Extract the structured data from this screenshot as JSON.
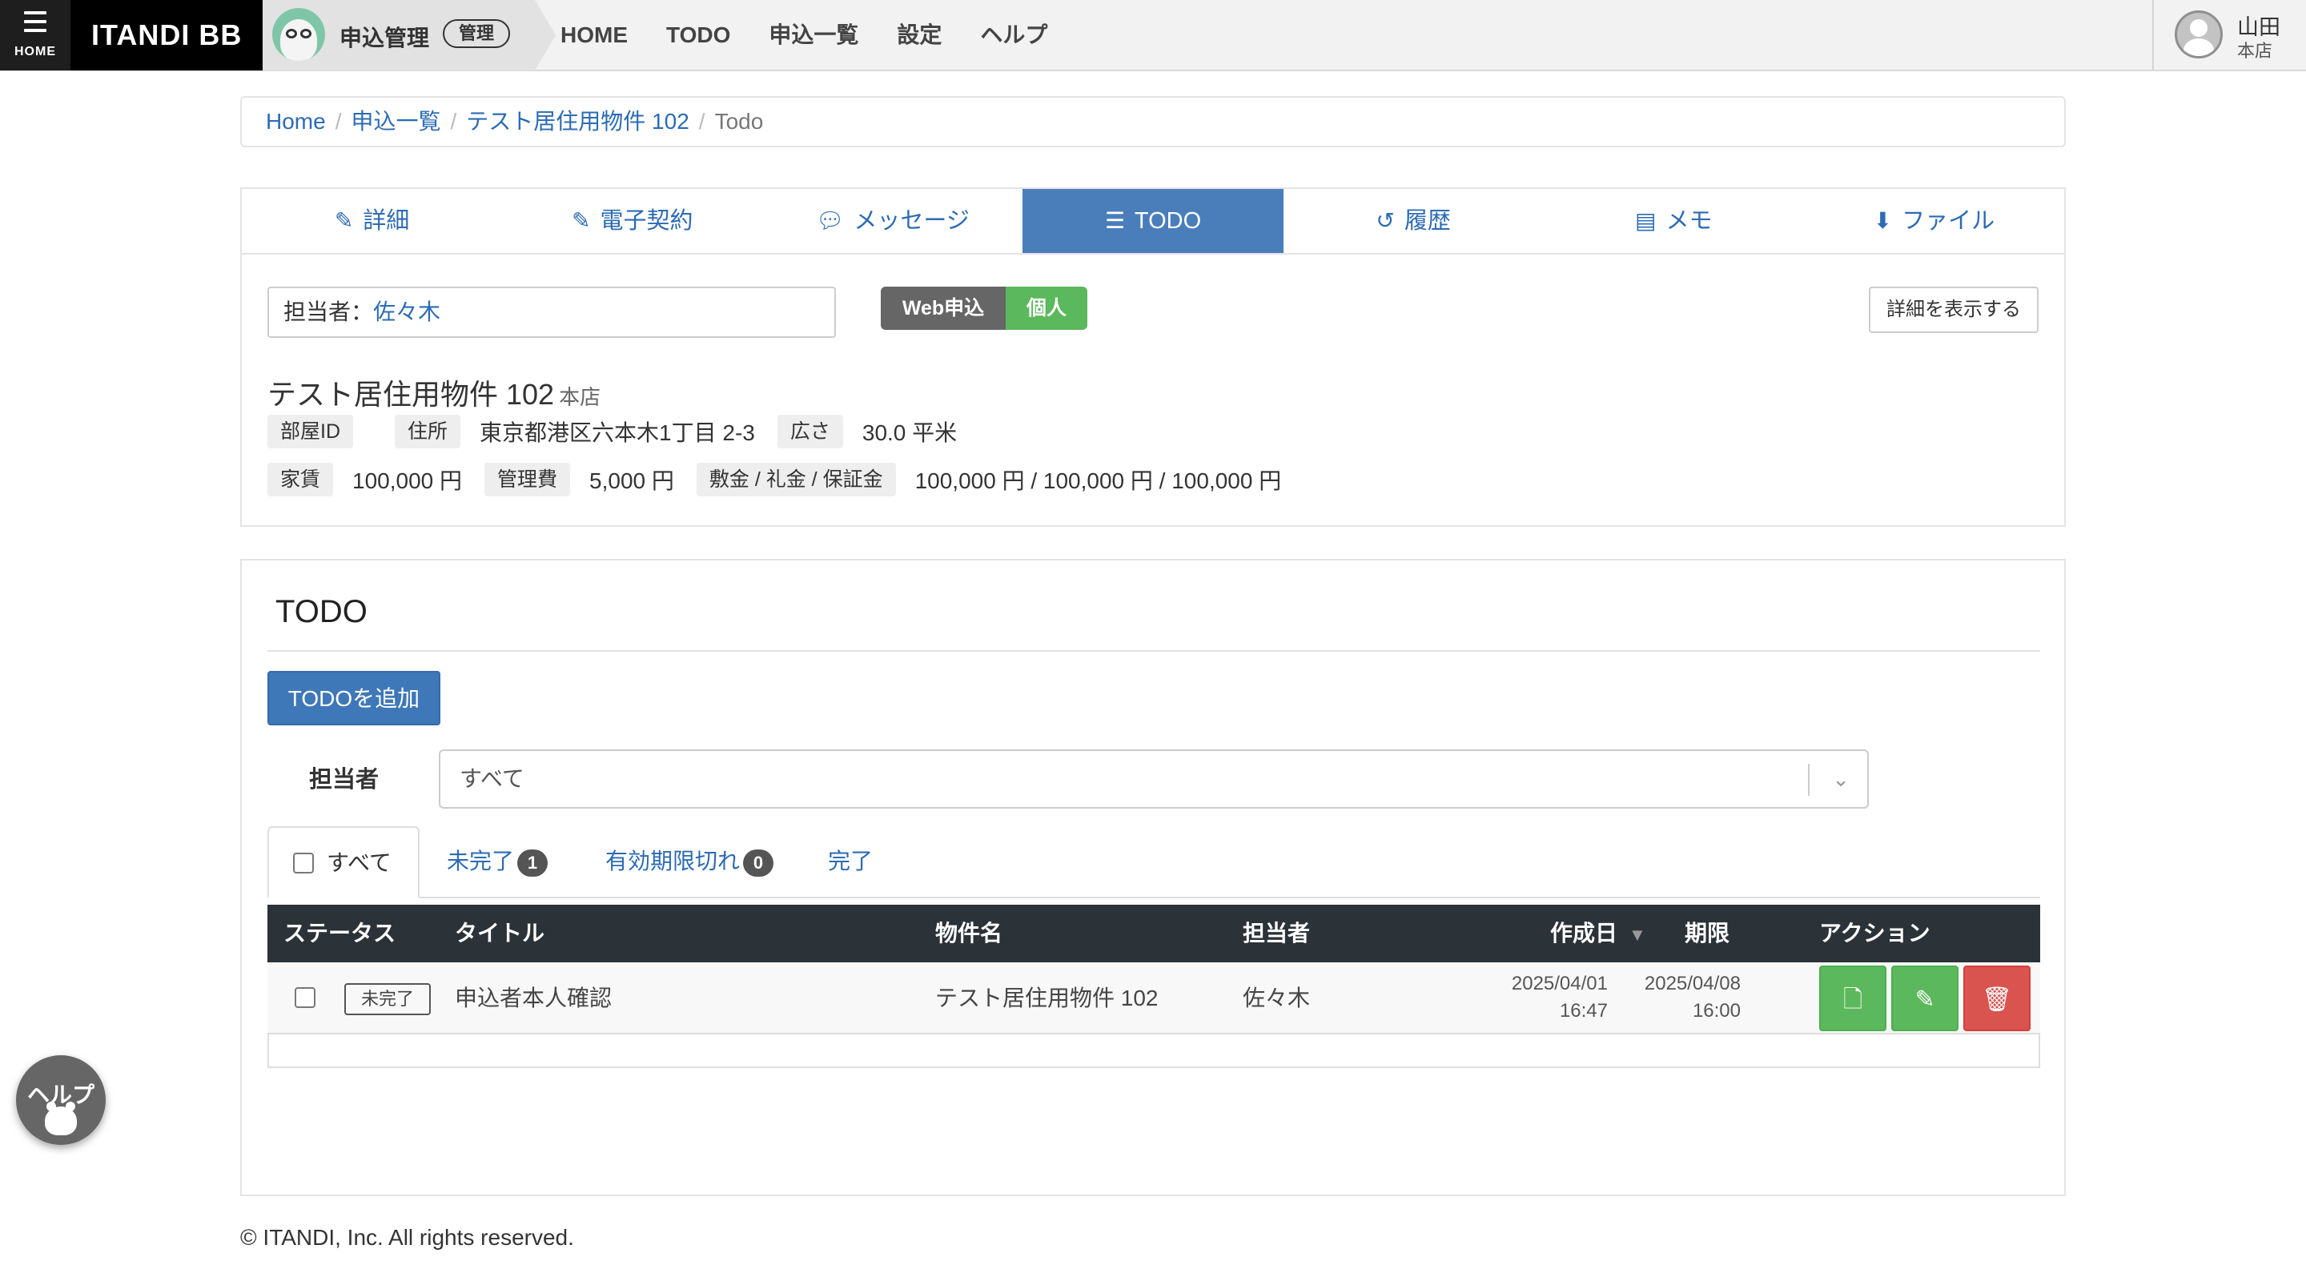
{
  "header": {
    "home_label": "HOME",
    "brand": "ITANDI BB",
    "app_title": "申込管理",
    "app_badge": "管理",
    "nav": [
      "HOME",
      "TODO",
      "申込一覧",
      "設定",
      "ヘルプ"
    ],
    "user_name": "山田",
    "user_store": "本店"
  },
  "breadcrumb": {
    "items": [
      "Home",
      "申込一覧",
      "テスト居住用物件 102"
    ],
    "current": "Todo"
  },
  "tabs": [
    {
      "label": "詳細",
      "icon": "edit-icon"
    },
    {
      "label": "電子契約",
      "icon": "edit-icon"
    },
    {
      "label": "メッセージ",
      "icon": "chat-icon"
    },
    {
      "label": "TODO",
      "icon": "list-icon",
      "active": true
    },
    {
      "label": "履歴",
      "icon": "history-icon"
    },
    {
      "label": "メモ",
      "icon": "memo-icon"
    },
    {
      "label": "ファイル",
      "icon": "download-icon"
    }
  ],
  "detail": {
    "assignee_label": "担当者：",
    "assignee_name": "佐々木",
    "badge_web": "Web申込",
    "badge_type": "個人",
    "show_detail_button": "詳細を表示する",
    "property_name": "テスト居住用物件 102",
    "property_store": "本店",
    "room_id_label": "部屋ID",
    "room_id_value": "",
    "address_label": "住所",
    "address_value": "東京都港区六本木1丁目 2-3",
    "area_label": "広さ",
    "area_value": "30.0 平米",
    "rent_label": "家賃",
    "rent_value": "100,000 円",
    "mgmt_label": "管理費",
    "mgmt_value": "5,000 円",
    "deposit_label": "敷金 / 礼金 / 保証金",
    "deposit_value": "100,000 円 / 100,000 円 / 100,000 円"
  },
  "todo": {
    "heading": "TODO",
    "add_button": "TODOを追加",
    "filter_label": "担当者",
    "filter_value": "すべて",
    "status_tabs": {
      "all": "すべて",
      "incomplete": "未完了",
      "incomplete_count": "1",
      "expired": "有効期限切れ",
      "expired_count": "0",
      "done": "完了"
    },
    "columns": {
      "status": "ステータス",
      "title": "タイトル",
      "property": "物件名",
      "assignee": "担当者",
      "created": "作成日",
      "due": "期限",
      "action": "アクション"
    },
    "rows": [
      {
        "status": "未完了",
        "title": "申込者本人確認",
        "property": "テスト居住用物件 102",
        "assignee": "佐々木",
        "created_date": "2025/04/01",
        "created_time": "16:47",
        "due_date": "2025/04/08",
        "due_time": "16:00"
      }
    ]
  },
  "footer": {
    "copyright": "© ITANDI, Inc. All rights reserved."
  },
  "help_float": "ヘルプ",
  "colors": {
    "primary": "#3f78b8",
    "active_tab": "#4a7ebb",
    "success": "#5cb85c",
    "danger": "#d9534f",
    "table_head": "#2b3238",
    "link": "#2c6bb4"
  }
}
